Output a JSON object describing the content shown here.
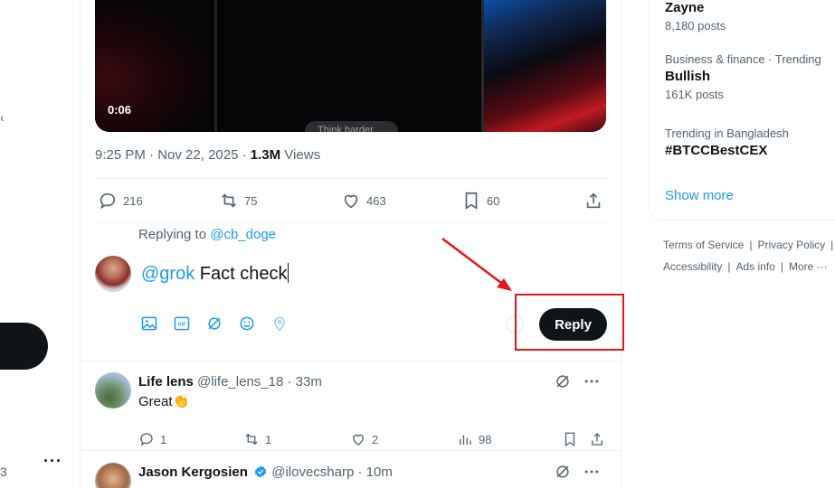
{
  "left": {
    "mark": "‹",
    "count": "3"
  },
  "video": {
    "time": "0:06",
    "overlay_label": "Think harder"
  },
  "post_meta": {
    "time": "9:25 PM",
    "date": "Nov 22, 2025",
    "views_count": "1.3M",
    "views_label": "Views"
  },
  "actions": {
    "replies": "216",
    "reposts": "75",
    "likes": "463",
    "bookmarks": "60"
  },
  "reply": {
    "replying_to_label": "Replying to",
    "replying_to_handle": "@cb_doge",
    "mention": "@grok",
    "text": " Fact check",
    "button": "Reply"
  },
  "comments": [
    {
      "name": "Life lens",
      "handle": "@life_lens_18",
      "time": "33m",
      "text": "Great👏",
      "replies": "1",
      "reposts": "1",
      "likes": "2",
      "views": "98"
    },
    {
      "name": "Jason Kergosien",
      "handle": "@ilovecsharp",
      "time": "10m"
    }
  ],
  "sidebar": {
    "trends": [
      {
        "title": "Zayne",
        "count": "8,180 posts"
      },
      {
        "category": "Business & finance · Trending",
        "title": "Bullish",
        "count": "161K posts"
      },
      {
        "category": "Trending in Bangladesh",
        "title": "#BTCCBestCEX"
      }
    ],
    "show_more": "Show more",
    "footer": [
      "Terms of Service",
      "Privacy Policy",
      "Accessibility",
      "Ads info",
      "More ···"
    ]
  },
  "colors": {
    "accent": "#1d9bf0",
    "annotation": "#e3161c",
    "text": "#0f1419",
    "muted": "#536471"
  }
}
